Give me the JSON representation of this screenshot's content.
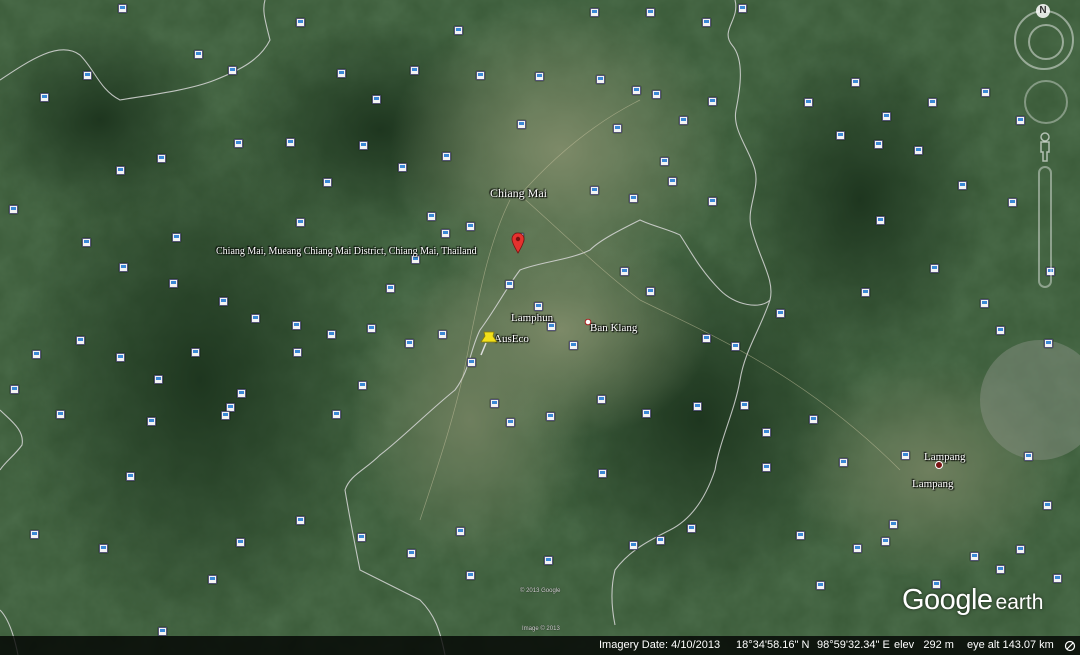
{
  "map": {
    "labels": {
      "chiang_mai": "Chiang Mai",
      "address": "Chiang Mai, Mueang Chiang Mai District, Chiang Mai, Thailand",
      "lamphun": "Lamphun",
      "ban_klang": "Ban Klang",
      "auseco": "AusEco",
      "lampang_1": "Lampang",
      "lampang_2": "Lampang"
    },
    "copyright_1": "© 2013 Google",
    "copyright_2": "Image © 2013"
  },
  "logo": {
    "google": "Google",
    "earth": "earth"
  },
  "navigation": {
    "north_label": "N"
  },
  "status_bar": {
    "imagery_date": "Imagery Date: 4/10/2013",
    "latitude": "18°34'58.16\" N",
    "longitude": "98°59'32.34\" E",
    "elev": "elev   292 m",
    "eye_alt": "eye alt 143.07 km"
  },
  "colors": {
    "terrain_dark": "#2c4a2c",
    "terrain_valley": "#6f7f5c",
    "border_line": "#d8d8d8",
    "pin_red": "#e5322e",
    "pushpin_yellow": "#f2e01a"
  }
}
